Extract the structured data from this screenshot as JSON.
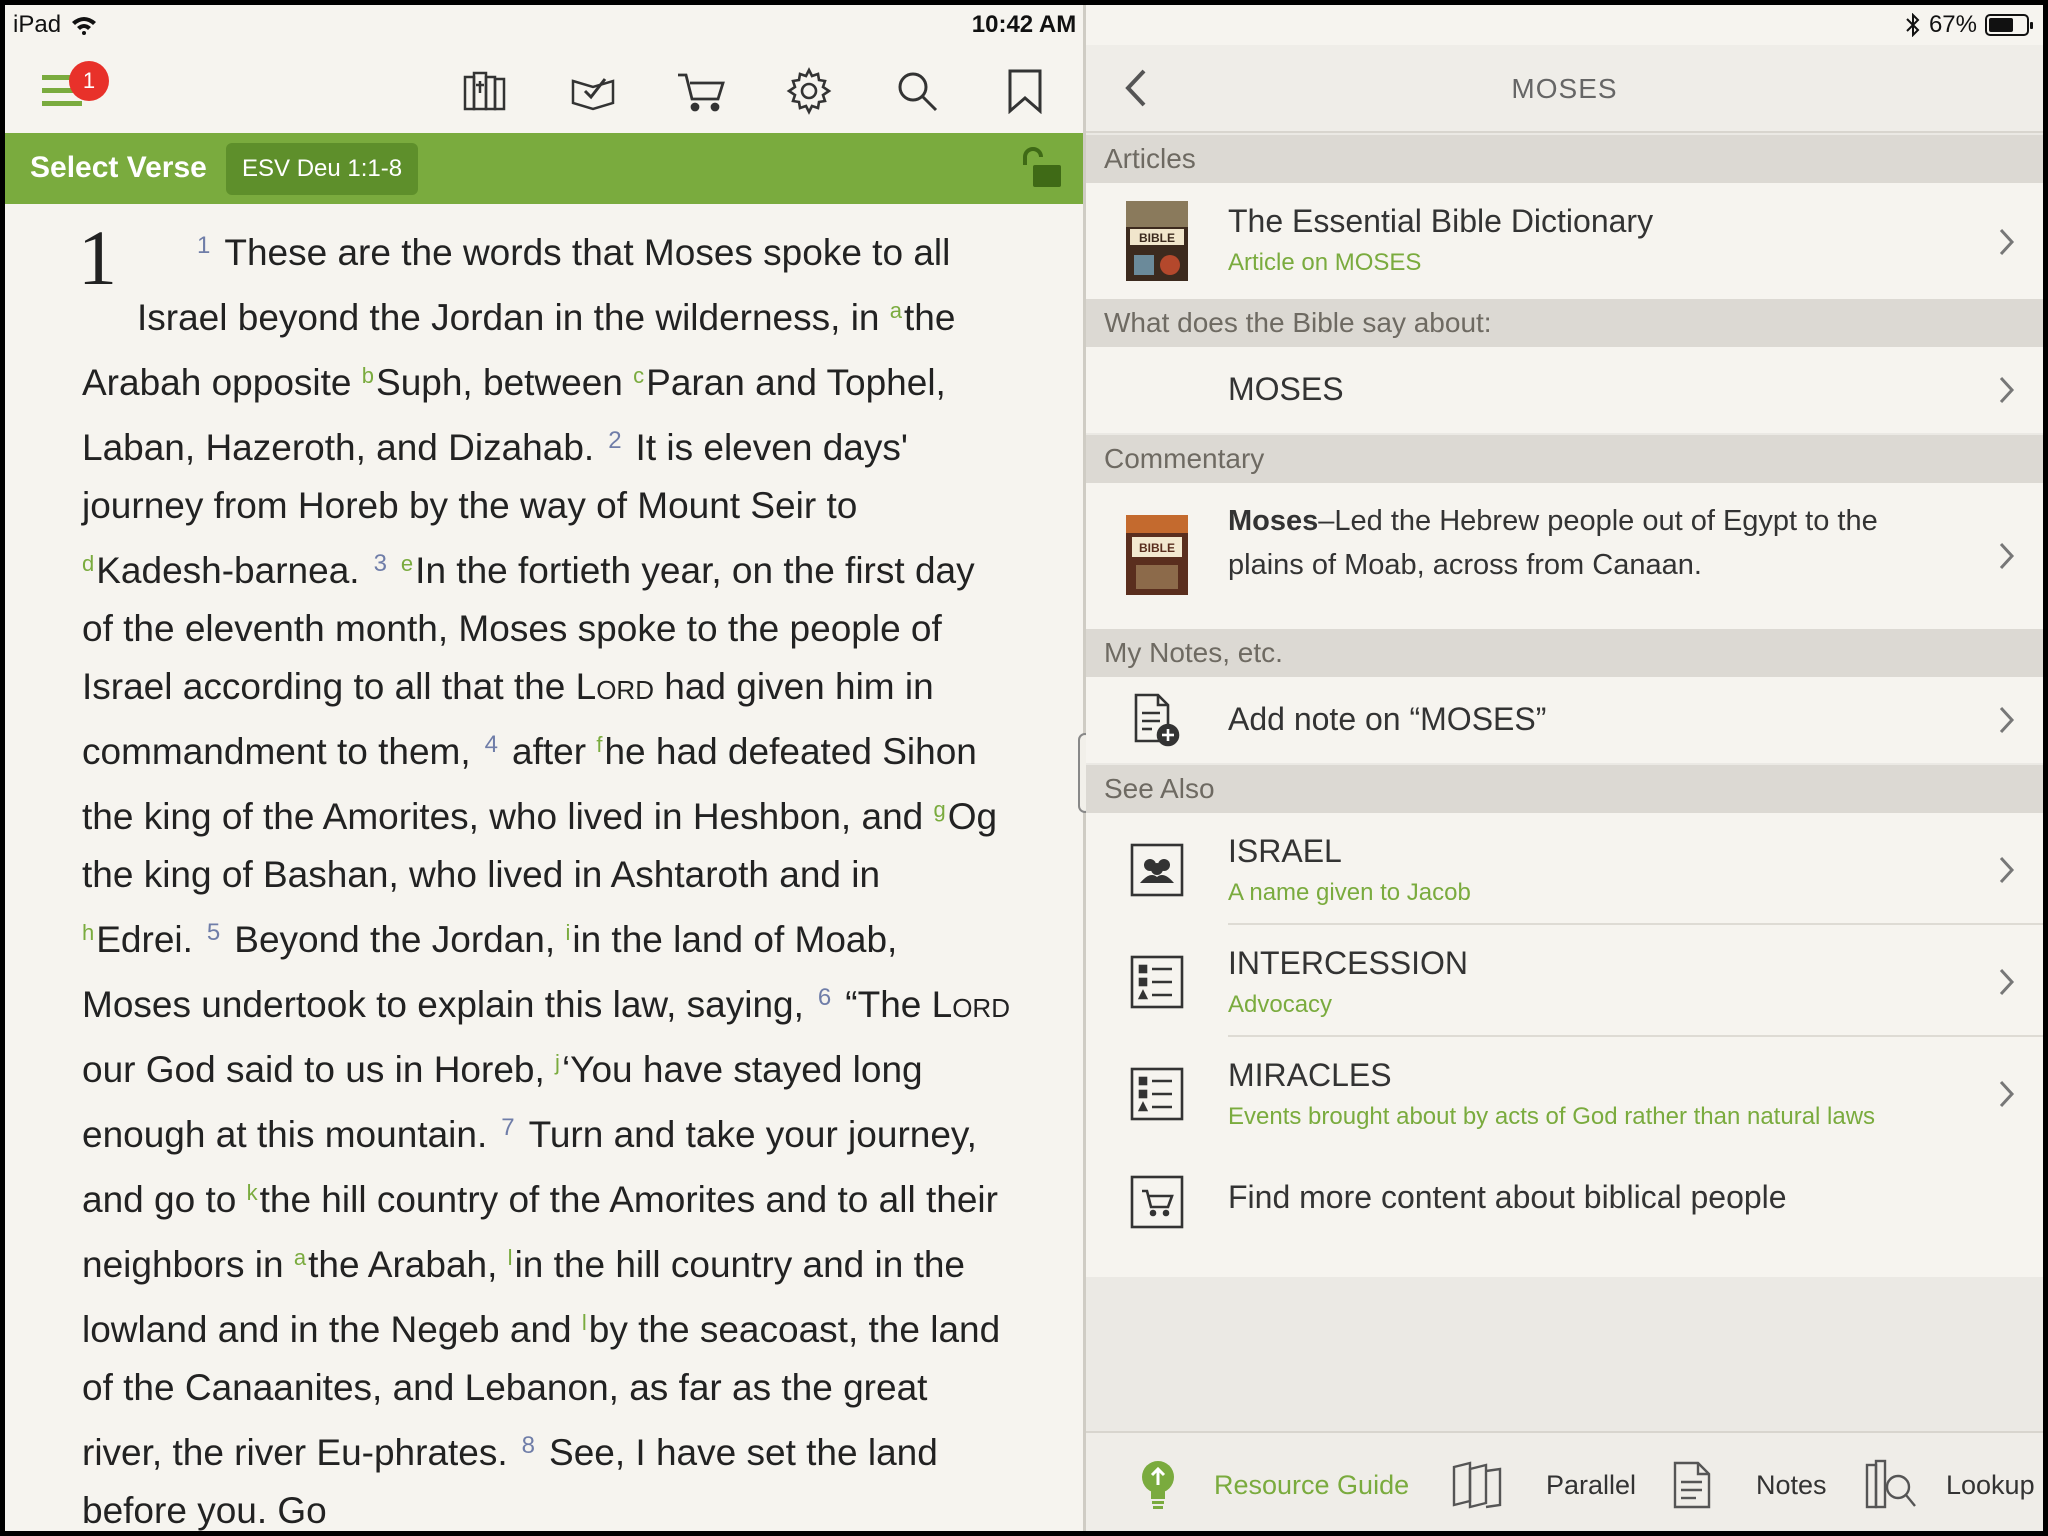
{
  "status_bar": {
    "device": "iPad",
    "time": "10:42 AM",
    "battery": "67%",
    "battery_level": 0.67
  },
  "toolbar": {
    "notification_count": "1",
    "icons": [
      "menu-icon",
      "library-icon",
      "reading-plan-icon",
      "cart-icon",
      "gear-icon",
      "search-icon",
      "bookmark-icon"
    ]
  },
  "verse_bar": {
    "select_label": "Select Verse",
    "reference": "ESV Deu 1:1-8"
  },
  "scripture": {
    "chapter": "1",
    "v1": "1",
    "v1_text_a": "These are the words that Moses spoke to all Israel beyond the Jordan in the wilderness, in ",
    "fn_a": "a",
    "v1_text_b": "the Arabah opposite ",
    "fn_b": "b",
    "v1_text_c": "Suph, between ",
    "fn_c": "c",
    "v1_text_d": "Paran and Tophel, Laban, Hazeroth, and Dizahab.",
    "v2": "2",
    "v2_text_a": "It is eleven days' journey from Horeb by the way of Mount Seir to ",
    "fn_d": "d",
    "v2_text_b": "Kadesh-barnea.",
    "v3": "3",
    "fn_e": "e",
    "v3_text_a": "In the fortieth year, on the first day of the eleventh month, Moses spoke to the people of Israel according to all that the ",
    "lord_1": "Lord",
    "v3_text_b": " had given him in commandment to them,",
    "v4": "4",
    "v4_text_a": "after ",
    "fn_f": "f",
    "v4_text_b": "he had defeated Sihon the king of the Amorites, who lived in Heshbon, and ",
    "fn_g": "g",
    "v4_text_c": "Og the king of Bashan, who lived in Ashtaroth and in ",
    "fn_h": "h",
    "v4_text_d": "Edrei.",
    "v5": "5",
    "v5_text_a": "Beyond the Jordan, ",
    "fn_i": "i",
    "v5_text_b": "in the land of Moab, Moses undertook to explain this law, saying,",
    "v6": "6",
    "v6_text_a": "“The ",
    "lord_2": "Lord",
    "v6_text_b": " our God said to us in Horeb, ",
    "fn_j": "j",
    "v6_text_c": "‘You have stayed long enough at this mountain.",
    "v7": "7",
    "v7_text_a": "Turn and take your journey, and go to ",
    "fn_k": "k",
    "v7_text_b": "the hill country of the Amorites and to all their neighbors in ",
    "fn_a2": "a",
    "v7_text_c": "the Arabah, ",
    "fn_l": "l",
    "v7_text_d": "in the hill country and in the lowland and in the Negeb and ",
    "fn_l2": "l",
    "v7_text_e": "by the seacoast, the land of the Canaanites, and Lebanon, as far as the great river, the river Eu-phrates.",
    "v8": "8",
    "v8_text_a": "See, I have set the land before you. Go"
  },
  "guide": {
    "title": "MOSES",
    "sections": {
      "articles": "Articles",
      "bible_says": "What does the Bible say about:",
      "commentary": "Commentary",
      "notes": "My Notes, etc.",
      "see_also": "See Also"
    },
    "article": {
      "title": "The Essential Bible Dictionary",
      "subtitle": "Article on MOSES",
      "thumb_text": "BIBLE"
    },
    "bible_topic": "MOSES",
    "commentary": {
      "bold": "Moses",
      "text": "–Led the Hebrew people out of Egypt to the plains of Moab, across from Canaan.",
      "thumb_text": "BIBLE"
    },
    "add_note": "Add note on “MOSES”",
    "see_also": [
      {
        "title": "ISRAEL",
        "subtitle": "A name given to Jacob",
        "icon": "people-icon"
      },
      {
        "title": "INTERCESSION",
        "subtitle": "Advocacy",
        "icon": "list-icon"
      },
      {
        "title": "MIRACLES",
        "subtitle": "Events brought about by acts of God rather than natural laws",
        "icon": "list-icon"
      }
    ],
    "find_more": "Find more content about biblical people"
  },
  "bottom_tabs": [
    {
      "label": "Resource Guide",
      "icon": "lightbulb-icon",
      "active": true
    },
    {
      "label": "Parallel",
      "icon": "parallel-books-icon",
      "active": false
    },
    {
      "label": "Notes",
      "icon": "notes-icon",
      "active": false
    },
    {
      "label": "Lookup",
      "icon": "lookup-icon",
      "active": false
    }
  ],
  "colors": {
    "accent_green": "#7aab3e",
    "badge_red": "#e8312a",
    "verse_number": "#6f7da8",
    "background": "#f6f4ef"
  }
}
